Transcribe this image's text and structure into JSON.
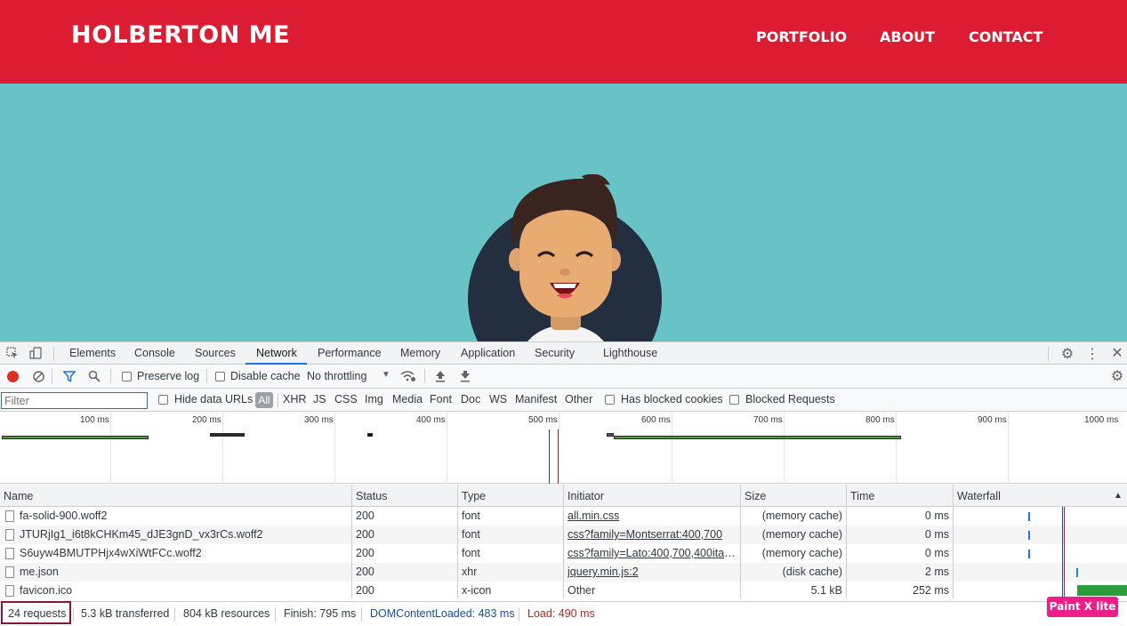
{
  "site": {
    "title": "HOLBERTON ME",
    "nav": [
      "PORTFOLIO",
      "ABOUT",
      "CONTACT"
    ],
    "colors": {
      "header": "#db1c32",
      "hero": "#68c3c6"
    }
  },
  "devtools": {
    "tabs": [
      "Elements",
      "Console",
      "Sources",
      "Network",
      "Performance",
      "Memory",
      "Application",
      "Security",
      "Lighthouse"
    ],
    "active_tab": "Network",
    "toolbar": {
      "preserve_log": "Preserve log",
      "disable_cache": "Disable cache",
      "throttling": "No throttling"
    },
    "filter": {
      "placeholder": "Filter",
      "hide_data_urls": "Hide data URLs",
      "types": [
        "All",
        "XHR",
        "JS",
        "CSS",
        "Img",
        "Media",
        "Font",
        "Doc",
        "WS",
        "Manifest",
        "Other"
      ],
      "has_blocked_cookies": "Has blocked cookies",
      "blocked_requests": "Blocked Requests"
    },
    "timeline_ticks": [
      "100 ms",
      "200 ms",
      "300 ms",
      "400 ms",
      "500 ms",
      "600 ms",
      "700 ms",
      "800 ms",
      "900 ms",
      "1000 ms"
    ],
    "columns": [
      "Name",
      "Status",
      "Type",
      "Initiator",
      "Size",
      "Time",
      "Waterfall"
    ],
    "rows": [
      {
        "name": "fa-solid-900.woff2",
        "status": "200",
        "type": "font",
        "initiator": "all.min.css",
        "size": "(memory cache)",
        "time": "0 ms"
      },
      {
        "name": "JTURjIg1_i6t8kCHKm45_dJE3gnD_vx3rCs.woff2",
        "status": "200",
        "type": "font",
        "initiator": "css?family=Montserrat:400,700",
        "size": "(memory cache)",
        "time": "0 ms"
      },
      {
        "name": "S6uyw4BMUTPHjx4wXiWtFCc.woff2",
        "status": "200",
        "type": "font",
        "initiator": "css?family=Lato:400,700,400itali...",
        "size": "(memory cache)",
        "time": "0 ms"
      },
      {
        "name": "me.json",
        "status": "200",
        "type": "xhr",
        "initiator": "jquery.min.js:2",
        "size": "(disk cache)",
        "time": "2 ms"
      },
      {
        "name": "favicon.ico",
        "status": "200",
        "type": "x-icon",
        "initiator": "Other",
        "size": "5.1 kB",
        "time": "252 ms"
      }
    ],
    "status_bar": {
      "requests": "24 requests",
      "transferred": "5.3 kB transferred",
      "resources": "804 kB resources",
      "finish": "Finish: 795 ms",
      "dom_content_loaded": "DOMContentLoaded: 483 ms",
      "load": "Load: 490 ms"
    },
    "colors": {
      "accent": "#1a73e8",
      "dcl": "#1a4aa8",
      "load": "#b3261e",
      "record": "#d93025"
    }
  },
  "overlay_badge": "Paint X lite"
}
